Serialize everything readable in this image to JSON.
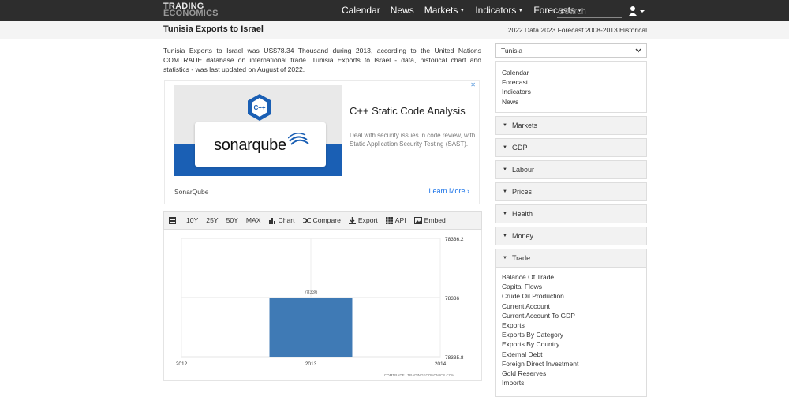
{
  "header": {
    "logo_line1": "TRADING",
    "logo_line2": "ECONOMICS",
    "nav": [
      {
        "label": "Calendar",
        "dropdown": false
      },
      {
        "label": "News",
        "dropdown": false
      },
      {
        "label": "Markets",
        "dropdown": true
      },
      {
        "label": "Indicators",
        "dropdown": true
      },
      {
        "label": "Forecasts",
        "dropdown": true
      }
    ],
    "search_placeholder": "Search",
    "user_icon": "user-icon"
  },
  "subheader": {
    "title": "Tunisia Exports to Israel",
    "meta": "2022 Data 2023 Forecast 2008-2013 Historical"
  },
  "description": "Tunisia Exports to Israel was US$78.34 Thousand during 2013, according to the United Nations COMTRADE database on international trade. Tunisia Exports to Israel - data, historical chart and statistics - was last updated on August of 2022.",
  "ad": {
    "logo_text": "sonarqube",
    "hex_label": "C++",
    "title": "C++ Static Code Analysis",
    "body": "Deal with security issues in code review, with Static Application Security Testing (SAST).",
    "brand": "SonarQube",
    "cta": "Learn More",
    "close": "✕"
  },
  "toolbar": {
    "items": [
      "10Y",
      "25Y",
      "50Y",
      "MAX",
      "Chart",
      "Compare",
      "Export",
      "API",
      "Embed"
    ]
  },
  "chart_data": {
    "type": "bar",
    "categories": [
      "2013"
    ],
    "values": [
      78336
    ],
    "data_labels": [
      "78336"
    ],
    "xlim": [
      2012,
      2014
    ],
    "x_ticks": [
      "2012",
      "2013",
      "2014"
    ],
    "ylim": [
      78335.8,
      78336.2
    ],
    "y_ticks": [
      "78336.2",
      "78336",
      "78335.8"
    ],
    "source": "COMTRADE | TRADINGECONOMICS.COM",
    "bar_color": "#3f7ab5",
    "grid": true
  },
  "sidebar": {
    "country": "Tunisia",
    "links": [
      "Calendar",
      "Forecast",
      "Indicators",
      "News"
    ],
    "sections": [
      "Markets",
      "GDP",
      "Labour",
      "Prices",
      "Health",
      "Money",
      "Trade"
    ],
    "trade_items": [
      "Balance Of Trade",
      "Capital Flows",
      "Crude Oil Production",
      "Current Account",
      "Current Account To GDP",
      "Exports",
      "Exports By Category",
      "Exports By Country",
      "External Debt",
      "Foreign Direct Investment",
      "Gold Reserves",
      "Imports"
    ]
  },
  "colors": {
    "topbar": "#2d2d2d",
    "link": "#1a73e8",
    "bar": "#3f7ab5"
  }
}
